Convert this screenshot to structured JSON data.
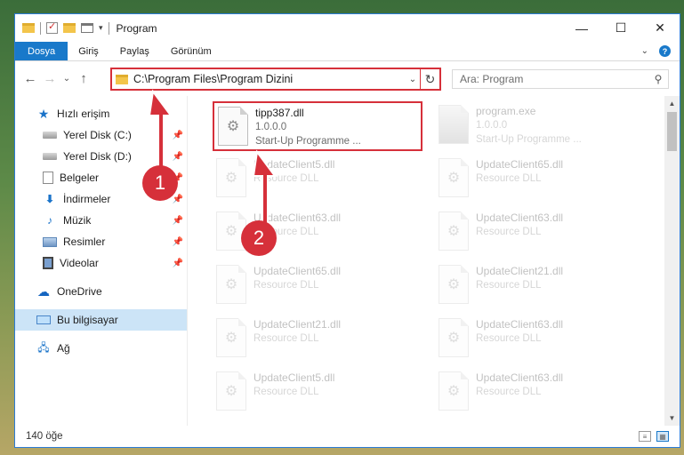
{
  "window": {
    "title": "Program"
  },
  "ribbon": {
    "tabs": [
      "Dosya",
      "Giriş",
      "Paylaş",
      "Görünüm"
    ]
  },
  "address": {
    "path": "C:\\Program Files\\Program Dizini"
  },
  "search": {
    "placeholder": "Ara: Program"
  },
  "nav": {
    "quick_access": "Hızlı erişim",
    "items": [
      {
        "label": "Yerel Disk (C:)",
        "icon": "drive-icon",
        "pinned": true
      },
      {
        "label": "Yerel Disk (D:)",
        "icon": "drive-icon",
        "pinned": true
      },
      {
        "label": "Belgeler",
        "icon": "documents-icon",
        "pinned": true
      },
      {
        "label": "İndirmeler",
        "icon": "downloads-icon",
        "pinned": true
      },
      {
        "label": "Müzik",
        "icon": "music-icon",
        "pinned": true
      },
      {
        "label": "Resimler",
        "icon": "pictures-icon",
        "pinned": true
      },
      {
        "label": "Videolar",
        "icon": "videos-icon",
        "pinned": true
      }
    ],
    "onedrive": "OneDrive",
    "this_pc": "Bu bilgisayar",
    "network": "Ağ"
  },
  "files": [
    {
      "name": "tipp387.dll",
      "line2": "1.0.0.0",
      "line3": "Start-Up Programme ...",
      "highlighted": true
    },
    {
      "name": "program.exe",
      "line2": "1.0.0.0",
      "line3": "Start-Up Programme ...",
      "faded": true
    },
    {
      "name": "UpdateClient5.dll",
      "line2": "Resource DLL",
      "faded": true
    },
    {
      "name": "UpdateClient65.dll",
      "line2": "Resource DLL",
      "faded": true
    },
    {
      "name": "UpdateClient63.dll",
      "line2": "Resource DLL",
      "faded": true
    },
    {
      "name": "UpdateClient63.dll",
      "line2": "Resource DLL",
      "faded": true
    },
    {
      "name": "UpdateClient65.dll",
      "line2": "Resource DLL",
      "faded": true
    },
    {
      "name": "UpdateClient21.dll",
      "line2": "Resource DLL",
      "faded": true
    },
    {
      "name": "UpdateClient21.dll",
      "line2": "Resource DLL",
      "faded": true
    },
    {
      "name": "UpdateClient63.dll",
      "line2": "Resource DLL",
      "faded": true
    },
    {
      "name": "UpdateClient5.dll",
      "line2": "Resource DLL",
      "faded": true
    },
    {
      "name": "UpdateClient63.dll",
      "line2": "Resource DLL",
      "faded": true
    }
  ],
  "status": {
    "count": "140 öğe"
  },
  "annotations": {
    "badge1": "1",
    "badge2": "2",
    "color": "#d6303a"
  }
}
